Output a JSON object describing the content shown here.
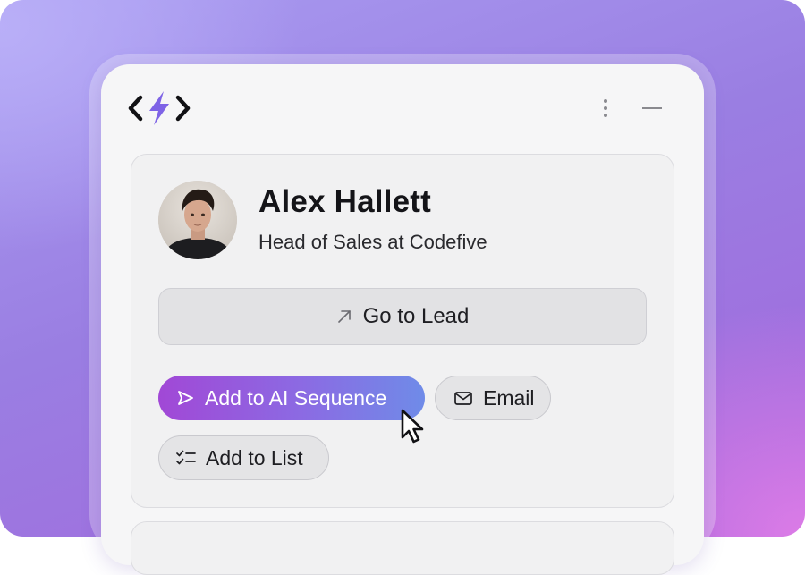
{
  "widget": {
    "logo_icon": "code-bolt-logo",
    "menu_icon": "kebab-menu-icon",
    "minimize_icon": "minimize-icon"
  },
  "contact": {
    "name": "Alex Hallett",
    "title": "Head of Sales at Codefive",
    "avatar": "profile-photo"
  },
  "actions": {
    "go_to_lead": {
      "label": "Go to Lead",
      "icon": "arrow-up-right-icon"
    },
    "add_to_ai_sequence": {
      "label": "Add to AI Sequence",
      "icon": "send-icon"
    },
    "email": {
      "label": "Email",
      "icon": "envelope-icon"
    },
    "add_to_list": {
      "label": "Add to List",
      "icon": "checklist-icon"
    }
  },
  "colors": {
    "accent_gradient_start": "#a148d6",
    "accent_gradient_end": "#6f8be8",
    "background_purple": "#9a7ee2"
  }
}
